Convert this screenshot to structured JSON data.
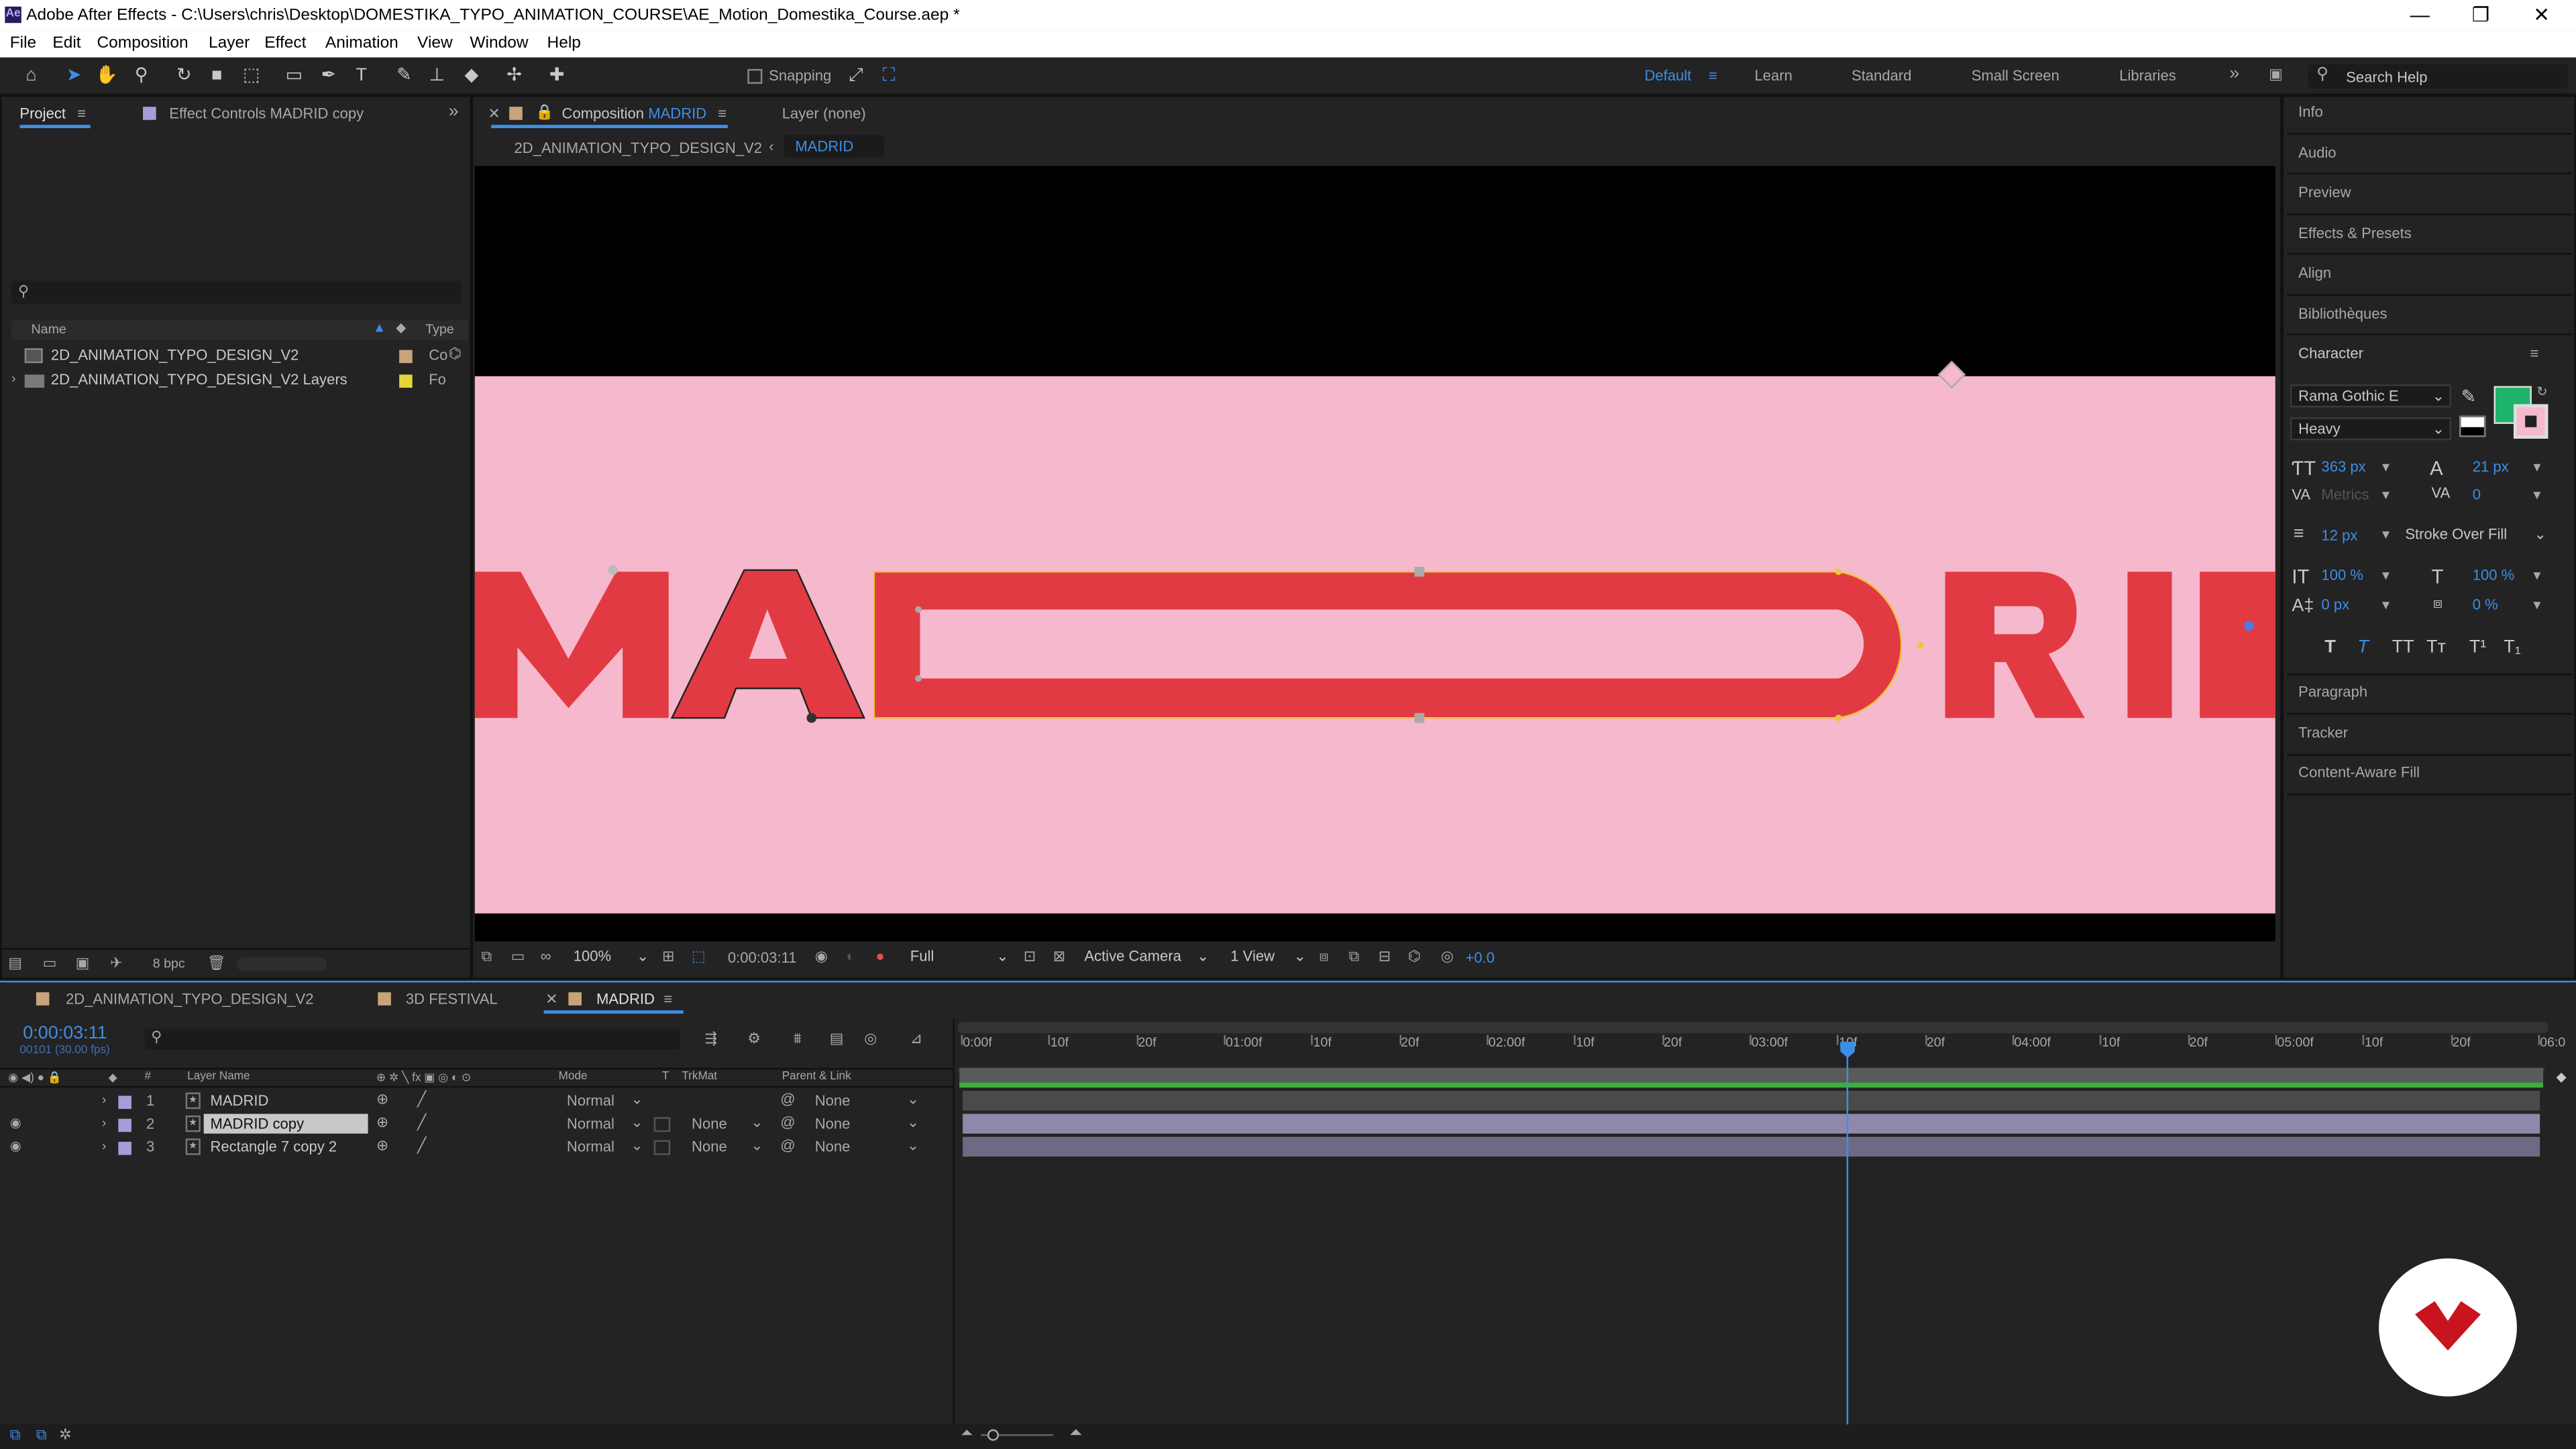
{
  "app": {
    "title": "Adobe After Effects - C:\\Users\\chris\\Desktop\\DOMESTIKA_TYPO_ANIMATION_COURSE\\AE_Motion_Domestika_Course.aep *",
    "logo": "Ae"
  },
  "window_controls": {
    "minimize": "—",
    "maximize": "❐",
    "close": "✕"
  },
  "menu": [
    "File",
    "Edit",
    "Composition",
    "Layer",
    "Effect",
    "Animation",
    "View",
    "Window",
    "Help"
  ],
  "toolbar": {
    "snapping_label": "Snapping",
    "workspaces": [
      "Default",
      "Learn",
      "Standard",
      "Small Screen",
      "Libraries"
    ],
    "active_workspace": "Default",
    "search_placeholder": "Search Help"
  },
  "project": {
    "tab": "Project",
    "effect_controls_tab": "Effect Controls MADRID copy",
    "col_name": "Name",
    "col_type": "Type",
    "items": [
      {
        "name": "2D_ANIMATION_TYPO_DESIGN_V2",
        "type": "Co",
        "color": "#c9a37a"
      },
      {
        "name": "2D_ANIMATION_TYPO_DESIGN_V2 Layers",
        "type": "Fo",
        "color": "#e6d23a"
      }
    ],
    "bpc": "8 bpc"
  },
  "composition": {
    "tab_prefix": "Composition",
    "tab_name": "MADRID",
    "layer_tab": "Layer (none)",
    "breadcrumb_parent": "2D_ANIMATION_TYPO_DESIGN_V2",
    "breadcrumb_current": "MADRID",
    "canvas_text": "MADRID",
    "zoom": "100%",
    "timecode": "0:00:03:11",
    "resolution": "Full",
    "camera": "Active Camera",
    "views": "1 View",
    "exposure": "+0.0"
  },
  "right_panel": {
    "panels": [
      "Info",
      "Audio",
      "Preview",
      "Effects & Presets",
      "Align",
      "Bibliothèques"
    ],
    "character": {
      "title": "Character",
      "font": "Rama Gothic E",
      "style": "Heavy",
      "size": "363 px",
      "leading": "21 px",
      "kerning": "Metrics",
      "tracking": "0",
      "stroke_width": "12 px",
      "stroke_mode": "Stroke Over Fill",
      "vert_scale": "100 %",
      "horiz_scale": "100 %",
      "baseline": "0 px",
      "tsume": "0 %",
      "fill_color": "#1eb36a",
      "stroke_color": "#f6b8cc"
    },
    "lower_panels": [
      "Paragraph",
      "Tracker",
      "Content-Aware Fill"
    ]
  },
  "timeline": {
    "tabs": [
      "2D_ANIMATION_TYPO_DESIGN_V2",
      "3D FESTIVAL",
      "MADRID"
    ],
    "active_tab": "MADRID",
    "timecode": "0:00:03:11",
    "frame_info": "00101 (30.00 fps)",
    "headers": {
      "layer_name": "Layer Name",
      "mode": "Mode",
      "t": "T",
      "trkmat": "TrkMat",
      "parent": "Parent & Link"
    },
    "layers": [
      {
        "num": "1",
        "name": "MADRID",
        "mode": "Normal",
        "trkmat": "",
        "parent": "None",
        "visible": false,
        "selected": false
      },
      {
        "num": "2",
        "name": "MADRID copy",
        "mode": "Normal",
        "trkmat": "None",
        "parent": "None",
        "visible": true,
        "selected": true
      },
      {
        "num": "3",
        "name": "Rectangle 7 copy 2",
        "mode": "Normal",
        "trkmat": "None",
        "parent": "None",
        "visible": true,
        "selected": false
      }
    ],
    "ruler": [
      "0:00f",
      "10f",
      "20f",
      "01:00f",
      "10f",
      "20f",
      "02:00f",
      "10f",
      "20f",
      "03:00f",
      "10f",
      "20f",
      "04:00f",
      "10f",
      "20f",
      "05:00f",
      "10f",
      "20f",
      "06:0"
    ],
    "playhead_seconds": 3.37
  },
  "colors": {
    "accent": "#3d8ee8",
    "canvas_bg": "#f6b8cc",
    "letter_fill": "#e23a43",
    "layer_bar": "#8f88ab",
    "work_area": "#3bb03b"
  }
}
